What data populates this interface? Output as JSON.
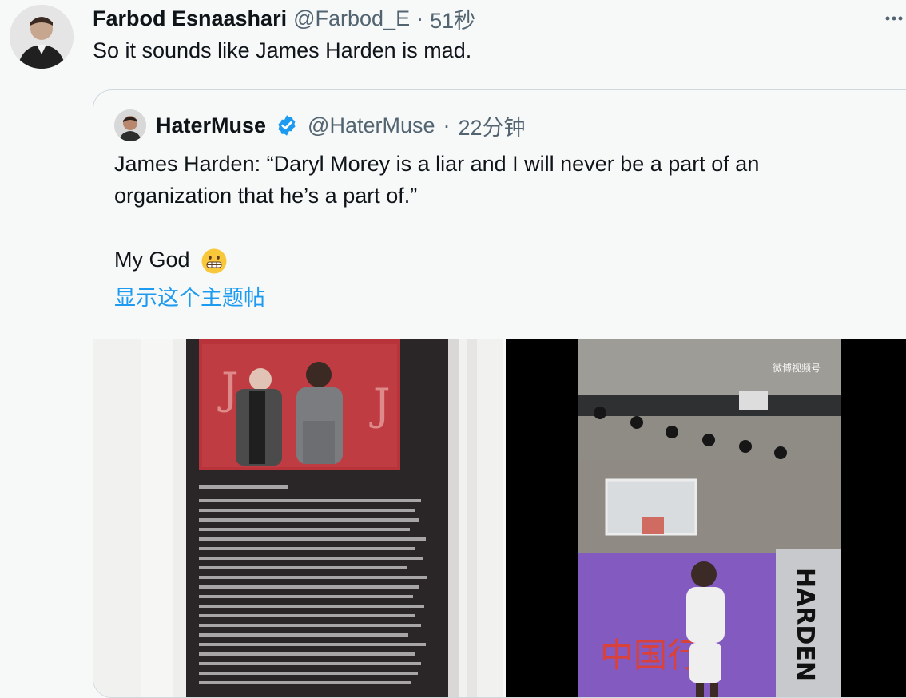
{
  "tweet": {
    "author_name": "Farbod Esnaashari",
    "author_handle": "@Farbod_E",
    "dot": "·",
    "time": "51秒",
    "text": "So it sounds like James Harden is mad.",
    "more_icon": "more-icon"
  },
  "quote": {
    "author_name": "HaterMuse",
    "verified_icon": "verified-badge-icon",
    "author_handle": "@HaterMuse",
    "dot": "·",
    "time": "22分钟",
    "line1": "James Harden: “Daryl Morey is a liar and I will never be a part of an",
    "line2": "organization that he’s a part of.”",
    "line3": "My God",
    "emoji_icon": "grimacing-face-emoji-icon",
    "show_thread_label": "显示这个主题帖"
  },
  "media": {
    "video": {
      "watermark": "微博视频号",
      "signage": "HARDEN"
    }
  },
  "colors": {
    "background": "#f7f9f9",
    "link": "#1d9bf0",
    "secondary_text": "#536471",
    "primary_text": "#0f1419",
    "verified": "#1d9bf0"
  }
}
